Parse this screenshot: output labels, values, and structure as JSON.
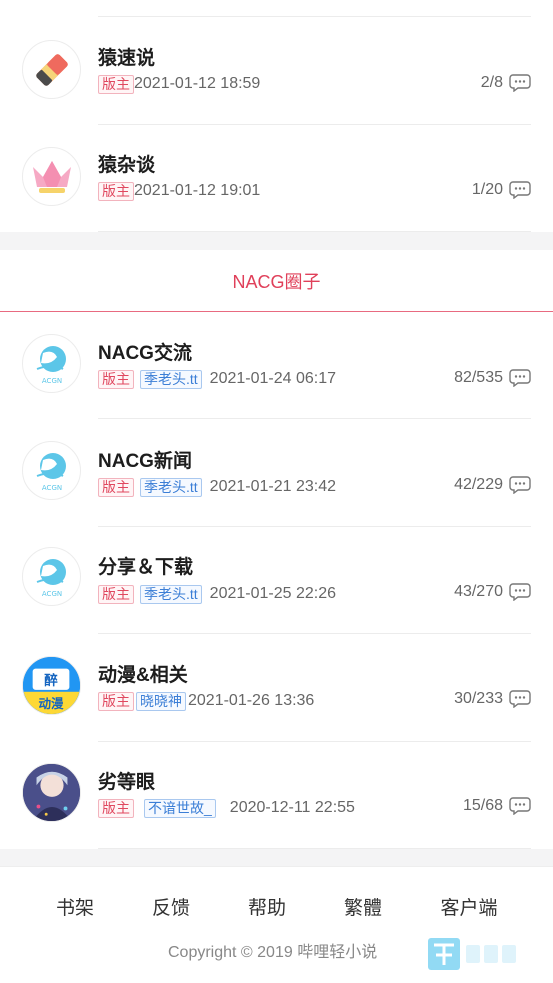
{
  "top_section": {
    "rows": [
      {
        "title": "猿速说",
        "mod_tag": "版主",
        "date": "2021-01-12 18:59",
        "count": "2/8",
        "avatar_icon": "pencil-eraser-icon"
      },
      {
        "title": "猿杂谈",
        "mod_tag": "版主",
        "date": "2021-01-12 19:01",
        "count": "1/20",
        "avatar_icon": "crown-icon"
      }
    ]
  },
  "nacg_section": {
    "title": "NACG圈子",
    "rows": [
      {
        "title": "NACG交流",
        "mod_tag": "版主",
        "moderator": "季老头.tt",
        "date": "2021-01-24 06:17",
        "count": "82/535",
        "avatar_icon": "acgn-logo-icon"
      },
      {
        "title": "NACG新闻",
        "mod_tag": "版主",
        "moderator": "季老头.tt",
        "date": "2021-01-21 23:42",
        "count": "42/229",
        "avatar_icon": "acgn-logo-icon"
      },
      {
        "title": "分享＆下载",
        "mod_tag": "版主",
        "moderator": "季老头.tt",
        "date": "2021-01-25 22:26",
        "count": "43/270",
        "avatar_icon": "acgn-logo-icon"
      },
      {
        "title": "动漫&相关",
        "mod_tag": "版主",
        "moderator": "晓晓神",
        "date": "2021-01-26 13:36",
        "count": "30/233",
        "avatar_icon": "anime-avatar-icon"
      },
      {
        "title": "劣等眼",
        "mod_tag": "版主",
        "moderator": "不谙世故_",
        "date": "2020-12-11 22:55",
        "count": "15/68",
        "avatar_icon": "character-avatar-icon"
      }
    ]
  },
  "footer": {
    "nav": [
      "书架",
      "反馈",
      "帮助",
      "繁體",
      "客户端"
    ],
    "copyright": "Copyright © 2019 哔哩轻小说"
  },
  "colors": {
    "accent": "#e0405a",
    "user_tag": "#3b7ed6",
    "progress": "#9fd7cf"
  }
}
